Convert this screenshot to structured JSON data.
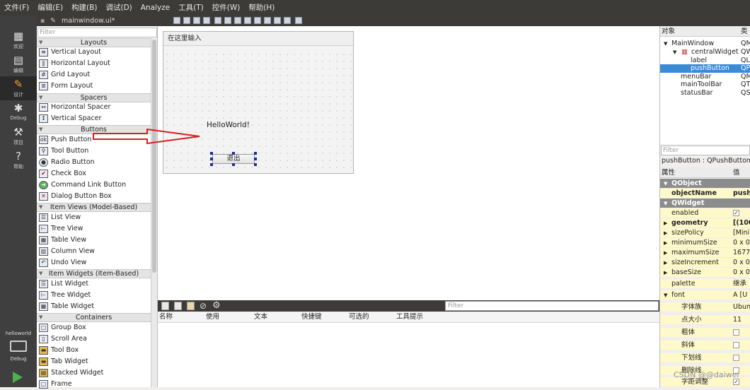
{
  "menubar": [
    "文件(F)",
    "编辑(E)",
    "构建(B)",
    "调试(D)",
    "Analyze",
    "工具(T)",
    "控件(W)",
    "帮助(H)"
  ],
  "modes": [
    {
      "icon": "grid-icon",
      "label": "欢迎"
    },
    {
      "icon": "document-icon",
      "label": "编辑"
    },
    {
      "icon": "pencil-icon",
      "label": "设计"
    },
    {
      "icon": "bug-icon",
      "label": "Debug"
    },
    {
      "icon": "wrench-icon",
      "label": "项目"
    },
    {
      "icon": "help-icon",
      "label": "帮助"
    }
  ],
  "kit": {
    "project": "helloworld",
    "config": "Debug"
  },
  "tab": {
    "filename": "mainwindow.ui*"
  },
  "widgetbox": {
    "filter_placeholder": "Filter",
    "sections": [
      {
        "title": "Layouts",
        "items": [
          "Vertical Layout",
          "Horizontal Layout",
          "Grid Layout",
          "Form Layout"
        ]
      },
      {
        "title": "Spacers",
        "items": [
          "Horizontal Spacer",
          "Vertical Spacer"
        ]
      },
      {
        "title": "Buttons",
        "items": [
          "Push Button",
          "Tool Button",
          "Radio Button",
          "Check Box",
          "Command Link Button",
          "Dialog Button Box"
        ]
      },
      {
        "title": "Item Views (Model-Based)",
        "items": [
          "List View",
          "Tree View",
          "Table View",
          "Column View",
          "Undo View"
        ]
      },
      {
        "title": "Item Widgets (Item-Based)",
        "items": [
          "List Widget",
          "Tree Widget",
          "Table Widget"
        ]
      },
      {
        "title": "Containers",
        "items": [
          "Group Box",
          "Scroll Area",
          "Tool Box",
          "Tab Widget",
          "Stacked Widget",
          "Frame"
        ]
      }
    ]
  },
  "form": {
    "menu_placeholder": "在这里输入",
    "label_text": "HelloWorld!",
    "button_text": "退出"
  },
  "actions": {
    "filter_placeholder": "Filter",
    "columns": [
      "名称",
      "使用",
      "文本",
      "快捷键",
      "可选的",
      "工具提示"
    ]
  },
  "objects": {
    "headers": [
      "对象",
      "类"
    ],
    "rows": [
      {
        "name": "MainWindow",
        "cls": "QM"
      },
      {
        "name": "centralWidget",
        "cls": "QW"
      },
      {
        "name": "label",
        "cls": "QL"
      },
      {
        "name": "pushButton",
        "cls": "QP"
      },
      {
        "name": "menuBar",
        "cls": "QM"
      },
      {
        "name": "mainToolBar",
        "cls": "QT"
      },
      {
        "name": "statusBar",
        "cls": "QS"
      }
    ]
  },
  "properties": {
    "filter_placeholder": "Filter",
    "title": "pushButton : QPushButton",
    "headers": [
      "属性",
      "值"
    ],
    "rows": [
      {
        "name": "QObject",
        "value": "",
        "group": true
      },
      {
        "name": "objectName",
        "value": "pushB"
      },
      {
        "name": "QWidget",
        "value": "",
        "group": true
      },
      {
        "name": "enabled",
        "value": "✓"
      },
      {
        "name": "geometry",
        "value": "[(100"
      },
      {
        "name": "sizePolicy",
        "value": "[Mini"
      },
      {
        "name": "minimumSize",
        "value": "0 x 0"
      },
      {
        "name": "maximumSize",
        "value": "1677"
      },
      {
        "name": "sizeIncrement",
        "value": "0 x 0"
      },
      {
        "name": "baseSize",
        "value": "0 x 0"
      },
      {
        "name": "palette",
        "value": "继承"
      },
      {
        "name": "font",
        "value": "A [U"
      },
      {
        "name": "字体族",
        "value": "Ubun"
      },
      {
        "name": "点大小",
        "value": "11"
      },
      {
        "name": "粗体",
        "value": ""
      },
      {
        "name": "斜体",
        "value": ""
      },
      {
        "name": "下划线",
        "value": ""
      },
      {
        "name": "删除线",
        "value": ""
      },
      {
        "name": "字距调整",
        "value": "✓"
      }
    ]
  },
  "watermark": "CSDN @@daiwei"
}
